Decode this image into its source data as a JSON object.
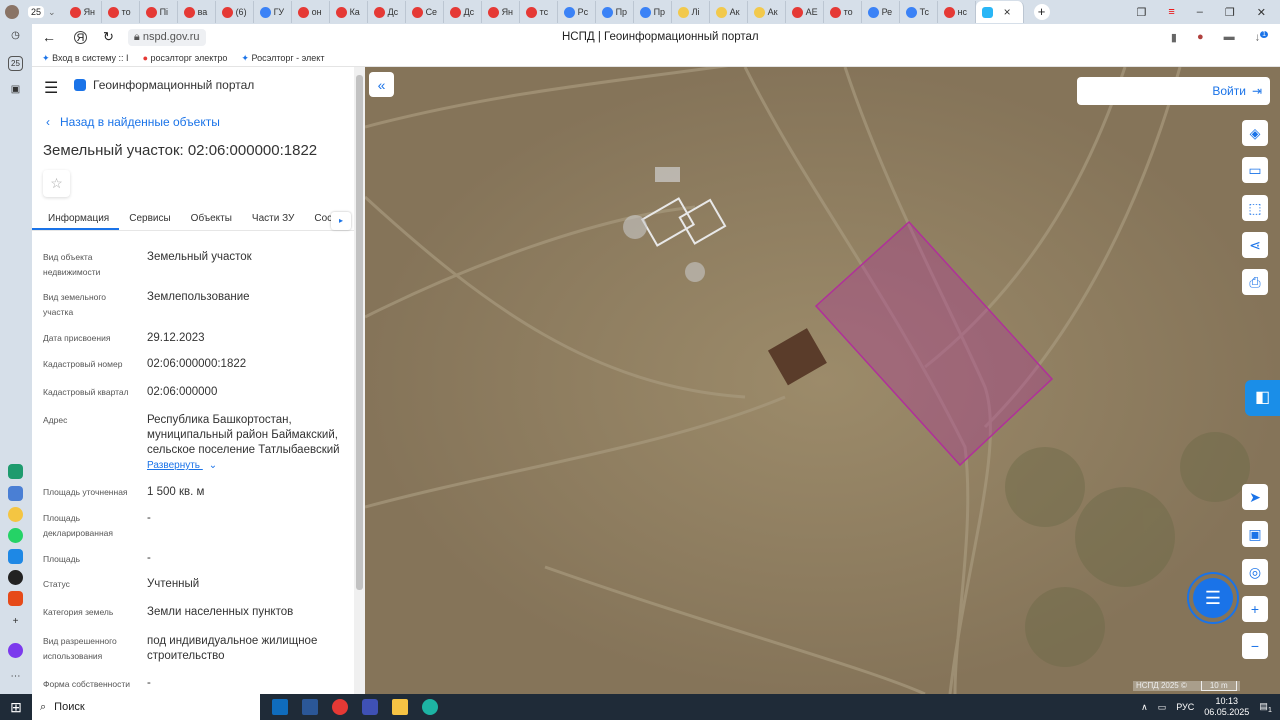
{
  "browser": {
    "tab_count_badge": "25",
    "tabs": [
      "Ян",
      "то",
      "Пі",
      "ва",
      "(6)",
      "ГУ",
      "он",
      "Ка",
      "Дс",
      "Се",
      "Дс",
      "Ян",
      "тс",
      "Рс",
      "Пр",
      "Пр",
      "Лі",
      "Ак",
      "Ак",
      "АЕ",
      "то",
      "Ре",
      "Тс",
      "нс"
    ],
    "active_tab_close": "×",
    "new_tab": "+",
    "url": "nspd.gov.ru",
    "page_title": "НСПД | Геоинформационный портал",
    "bookmarks": [
      "Вход в систему :: I",
      "росэлторг электро",
      "Росэлторг - элект"
    ],
    "download_badge": "1",
    "left_rail_badge": "25"
  },
  "panel": {
    "portal_title": "Геоинформационный портал",
    "back_link": "Назад в найденные объекты",
    "heading": "Земельный участок: 02:06:000000:1822",
    "tabs": [
      "Информация",
      "Сервисы",
      "Объекты",
      "Части ЗУ",
      "Соста"
    ],
    "fields": [
      {
        "label": "Вид объекта недвижимости",
        "value": "Земельный участок"
      },
      {
        "label": "Вид земельного участка",
        "value": "Землепользование"
      },
      {
        "label": "Дата присвоения",
        "value": "29.12.2023"
      },
      {
        "label": "Кадастровый номер",
        "value": "02:06:000000:1822"
      },
      {
        "label": "Кадастровый квартал",
        "value": "02:06:000000"
      },
      {
        "label": "Адрес",
        "value": "Республика Башкортостан, муниципальный район Баймакский, сельское поселение Татлыбаевский"
      },
      {
        "label": "Площадь уточненная",
        "value": "1 500 кв. м"
      },
      {
        "label": "Площадь декларированная",
        "value": "-"
      },
      {
        "label": "Площадь",
        "value": "-"
      },
      {
        "label": "Статус",
        "value": "Учтенный"
      },
      {
        "label": "Категория земель",
        "value": "Земли населенных пунктов"
      },
      {
        "label": "Вид разрешенного использования",
        "value": "под индивидуальное жилищное строительство"
      },
      {
        "label": "Форма собственности",
        "value": "-"
      }
    ],
    "expand_link": "Развернуть"
  },
  "map": {
    "login": "Войти",
    "attribution": "НСПД 2025 ©",
    "scale": "10 m",
    "parcel_color": "#b0309a"
  },
  "taskbar": {
    "search": "Поиск",
    "lang": "РУС",
    "time": "10:13",
    "date": "06.05.2025",
    "notif": "1"
  }
}
